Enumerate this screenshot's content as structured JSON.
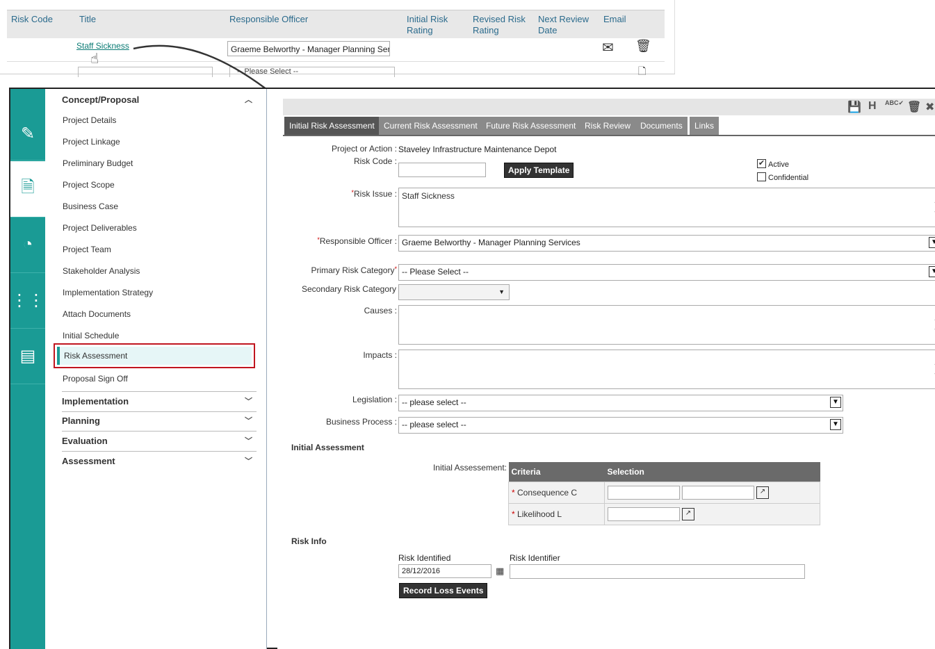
{
  "top_grid": {
    "headers": [
      "Risk Code",
      "Title",
      "Responsible Officer",
      "Initial Risk Rating",
      "Revised Risk Rating",
      "Next Review Date",
      "Email"
    ],
    "row": {
      "title": "Staff Sickness",
      "officer": "Graeme Belworthy - Manager Planning Ser"
    },
    "row2_select": "-- Please Select --"
  },
  "side_nav": {
    "sections": [
      {
        "label": "Concept/Proposal",
        "expanded": true
      },
      {
        "label": "Implementation",
        "expanded": false
      },
      {
        "label": "Planning",
        "expanded": false
      },
      {
        "label": "Evaluation",
        "expanded": false
      },
      {
        "label": "Assessment",
        "expanded": false
      }
    ],
    "items": [
      "Project Details",
      "Project Linkage",
      "Preliminary Budget",
      "Project Scope",
      "Business Case",
      "Project Deliverables",
      "Project Team",
      "Stakeholder Analysis",
      "Implementation Strategy",
      "Attach Documents",
      "Initial Schedule",
      "Risk Assessment",
      "Proposal Sign Off"
    ],
    "active_item": "Risk Assessment"
  },
  "toolbar": {
    "icons": [
      "save-icon",
      "history-icon",
      "spellcheck-icon",
      "delete-icon",
      "close-icon"
    ],
    "h_label": "H",
    "abc_label": "ABC"
  },
  "tabs": [
    "Initial Risk Assessment",
    "Current Risk Assessment",
    "Future Risk Assessment",
    "Risk Review",
    "Documents",
    "Links"
  ],
  "form": {
    "project_label": "Project or Action :",
    "project_value": "Staveley Infrastructure Maintenance Depot",
    "risk_code_label": "Risk Code :",
    "risk_code_value": "",
    "apply_template": "Apply Template",
    "active_label": "Active",
    "active_checked": true,
    "confidential_label": "Confidential",
    "confidential_checked": false,
    "risk_issue_label": "Risk Issue :",
    "risk_issue_value": "Staff Sickness",
    "officer_label": "Responsible Officer :",
    "officer_value": "Graeme Belworthy - Manager Planning Services",
    "primary_cat_label": "Primary Risk Category",
    "primary_cat_value": "-- Please Select --",
    "secondary_cat_label": "Secondary Risk Category",
    "secondary_cat_value": "",
    "causes_label": "Causes :",
    "impacts_label": "Impacts :",
    "legislation_label": "Legislation :",
    "legislation_value": "-- please select --",
    "business_process_label": "Business Process :",
    "business_process_value": "-- please select --"
  },
  "initial_assessment": {
    "title": "Initial Assessment",
    "label": "Initial Assessement:",
    "columns": [
      "Criteria",
      "Selection"
    ],
    "rows": [
      "Consequence C",
      "Likelihood L"
    ]
  },
  "risk_info": {
    "title": "Risk Info",
    "identified_label": "Risk Identified",
    "identified_value": "28/12/2016",
    "identifier_label": "Risk Identifier",
    "identifier_value": "",
    "record_button": "Record Loss Events"
  },
  "colors": {
    "teal": "#1a9b95",
    "tab_active": "#555555",
    "tab": "#8a8a8a",
    "highlight_border": "#c0151f"
  }
}
